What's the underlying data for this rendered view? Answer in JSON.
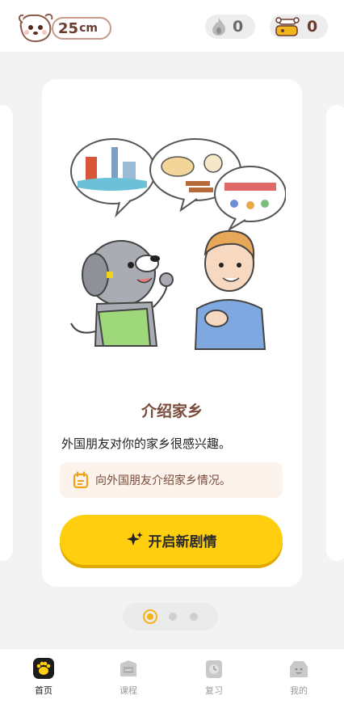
{
  "header": {
    "height_value": "25",
    "height_unit": "cm",
    "drops_count": "0",
    "bones_count": "0"
  },
  "card": {
    "title": "介绍家乡",
    "description": "外国朋友对你的家乡很感兴趣。",
    "task": "向外国朋友介绍家乡情况。",
    "start_button": "开启新剧情"
  },
  "pager": {
    "total": 3,
    "active": 1
  },
  "tabs": [
    {
      "label": "首页"
    },
    {
      "label": "课程"
    },
    {
      "label": "复习"
    },
    {
      "label": "我的"
    }
  ],
  "colors": {
    "accent_yellow": "#ffcf0f",
    "title_brown": "#7a4a3a",
    "pager_active": "#f6b21a"
  }
}
